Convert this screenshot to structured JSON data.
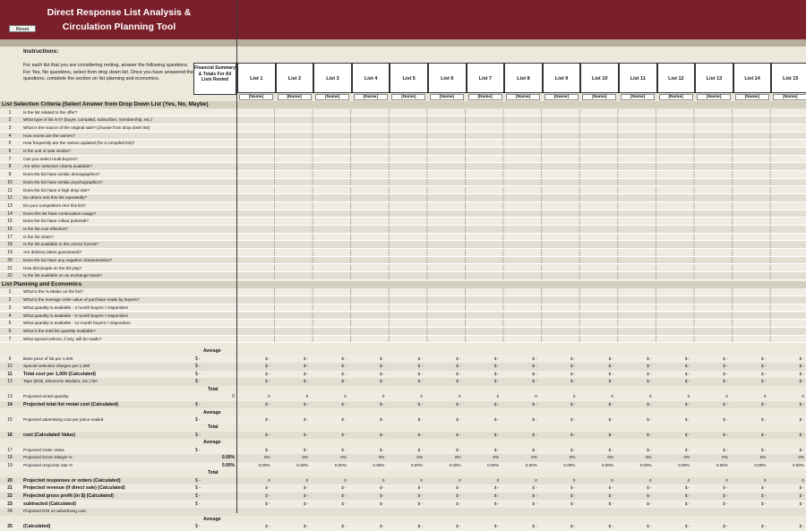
{
  "header": {
    "title_line1": "Direct Response List Analysis &",
    "title_line2": "Circulation Planning Tool",
    "reset_label": "Reset"
  },
  "instructions": {
    "heading": "Instructions:",
    "text": "For each list that you are considering renting, answer the following questions. For Yes, No questions, select from drop down list. Once you have answered the questions, complete the section on list planning and economics.",
    "financial_summary": "Financial Summary & Totals For All Lists Rented"
  },
  "lists": [
    "List 1",
    "List 2",
    "List 3",
    "List 4",
    "List 5",
    "List 6",
    "List 7",
    "List 8",
    "List 9",
    "List 10",
    "List 11",
    "List 12",
    "List 13",
    "List 14",
    "List 15"
  ],
  "name_placeholder": "[Name]",
  "selection_section": {
    "title": "List Selection Criteria (Select Answer from Drop Down List (Yes, No, Maybe)",
    "questions": [
      "Is the list related to the offer?",
      "What type of list is it? (buyer, compiled, subscriber, membership, etc.)",
      "What is the source of the original sale? (choose from drop down list)",
      "How recent are the names?",
      "How frequently are the names updated (for a compiled list)?",
      "Is the unit of sale similar?",
      "Can you select multi-buyers?",
      "Are other selection criteria available?",
      "Does the list have similar demographics?",
      "Does the list have similar psychographics?",
      "Does the list have a high drop rate?",
      "Do others rent this list repeatedly?",
      "Do your competitors rent this list?",
      "Does this list have continuation usage?",
      "Does the list have rollout potential?",
      "Is the list cost effective?",
      "Is the list clean?",
      "Is the list available in the correct format?",
      "Are delivery dates guaranteed?",
      "Does the list have any negative characteristics?",
      "How did people on the list pay?",
      "Is the list available on an exchange basis?"
    ]
  },
  "planning_section": {
    "title": "List Planning and Economics",
    "questions": [
      "What is the % Males on the list?",
      "What is the average order value of purchase made by buyers?",
      "What quantity is available - 3 month buyers / responders",
      "What quantity is available - 6 month buyers / responders",
      "What quantity is available - 12 month buyers / responders",
      "What is the total list quantity available?",
      "What special selects, if any, will be made?"
    ]
  },
  "labels": {
    "average": "Average",
    "total": "Total",
    "dollar": "$",
    "dash": "-",
    "zero": "0",
    "pct": "0.00%"
  },
  "economics": [
    {
      "n": "9",
      "q": "Base price of list per 1,000",
      "bold": false,
      "sum": "$ -",
      "cell": "$ -",
      "pre": "average"
    },
    {
      "n": "10",
      "q": "Special selection charges per 1,000",
      "bold": false,
      "sum": "$ -",
      "cell": "$ -",
      "pre": ""
    },
    {
      "n": "11",
      "q": "Total cost per 1,000 (Calculated)",
      "bold": true,
      "sum": "$ -",
      "cell": "$ -",
      "pre": ""
    },
    {
      "n": "12",
      "q": "Tape (Disk, Electronic Medium, etc.) fee",
      "bold": false,
      "sum": "$ -",
      "cell": "$ -",
      "pre": ""
    },
    {
      "n": "13",
      "q": "Projected rental quantity",
      "bold": false,
      "sum": "0",
      "cell": "0",
      "pre": "total"
    },
    {
      "n": "14",
      "q": "Projected total list rental cost (Calculated)",
      "bold": true,
      "sum": "$ -",
      "cell": "$ -",
      "pre": ""
    },
    {
      "n": "15",
      "q": "Projected advertising cost per piece mailed",
      "bold": false,
      "sum": "$ -",
      "cell": "$ -",
      "pre": "average"
    },
    {
      "n": "16",
      "q": "cost (Calculated Value)",
      "bold": true,
      "sum": "$ -",
      "cell": "$ -",
      "pre": "total"
    },
    {
      "n": "17",
      "q": "Projected Order Value",
      "bold": false,
      "sum": "$ -",
      "cell": "$ -",
      "pre": "average"
    },
    {
      "n": "18",
      "q": "Projected Gross Margin %",
      "bold": false,
      "sum": "0.00%",
      "cell": "0%",
      "pre": ""
    },
    {
      "n": "19",
      "q": "Projected response rate %",
      "bold": false,
      "sum": "0.00%",
      "cell": "0.00%",
      "pre": ""
    },
    {
      "n": "20",
      "q": "Projected responses or orders (Calculated)",
      "bold": true,
      "sum": "$ -",
      "cell": "0",
      "pre": "total"
    },
    {
      "n": "21",
      "q": "Projected revenue (if direct sale) (Calculated)",
      "bold": true,
      "sum": "$ -",
      "cell": "$ -",
      "pre": ""
    },
    {
      "n": "22",
      "q": "Projected gross profit (in $) (Calculated)",
      "bold": true,
      "sum": "$ -",
      "cell": "$ -",
      "pre": ""
    },
    {
      "n": "23",
      "q": "subtracted (Calculated)",
      "bold": true,
      "sum": "$ -",
      "cell": "$ -",
      "pre": ""
    },
    {
      "n": "24",
      "q": "Projected ROI on advertising cost",
      "bold": false,
      "sum": "",
      "cell": "",
      "pre": ""
    },
    {
      "n": "25",
      "q": "(Calculated)",
      "bold": true,
      "sum": "$ -",
      "cell": "$ -",
      "pre": "average"
    }
  ],
  "colors": {
    "banner": "#7b1f2b",
    "sheet_bg": "#ece9dc",
    "section_header": "#d4cfbf"
  }
}
